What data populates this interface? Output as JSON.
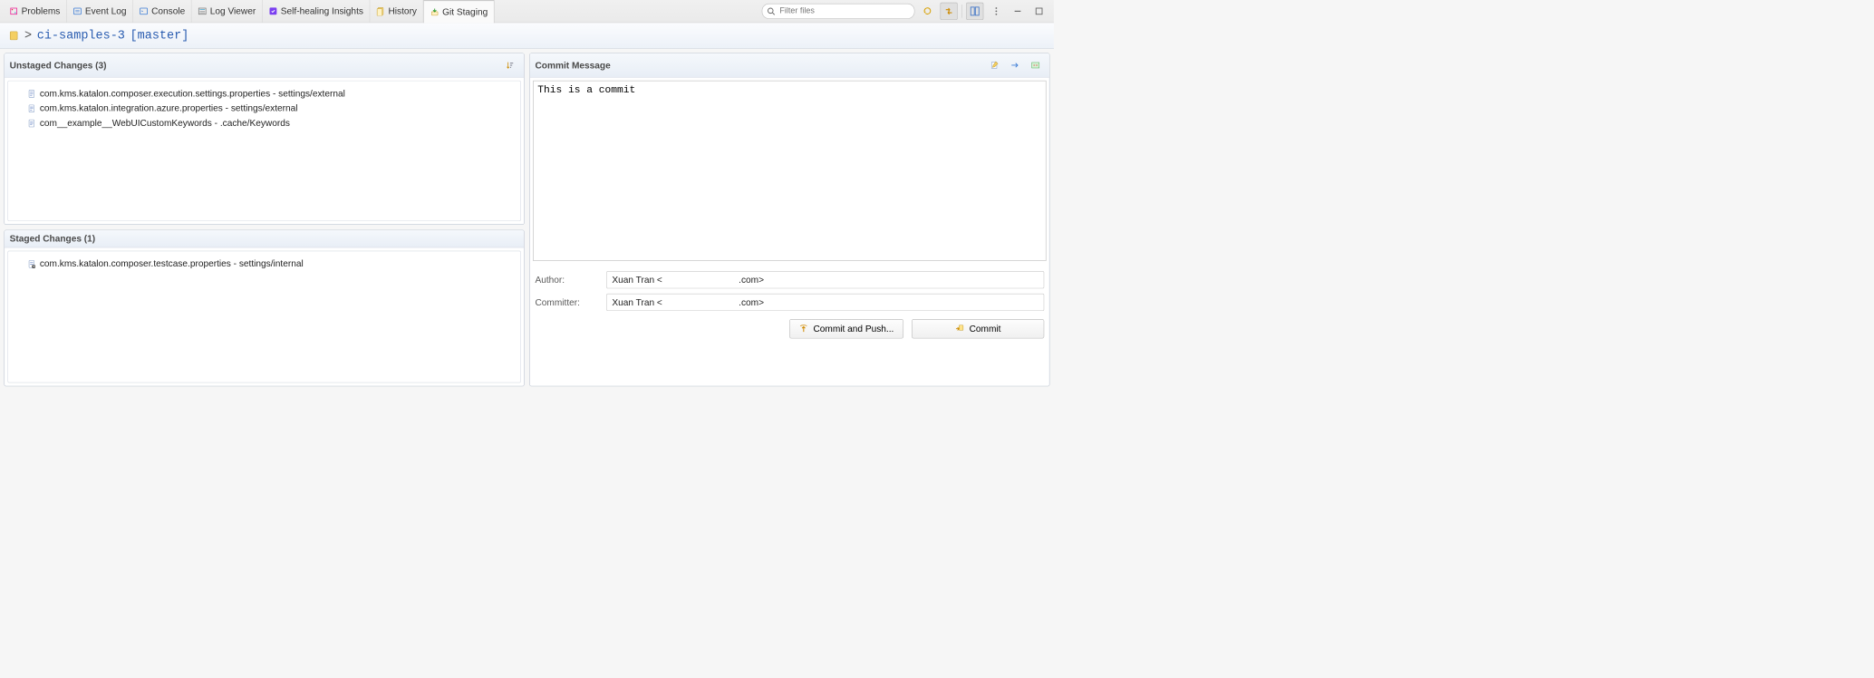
{
  "tabs": [
    {
      "label": "Problems"
    },
    {
      "label": "Event Log"
    },
    {
      "label": "Console"
    },
    {
      "label": "Log Viewer"
    },
    {
      "label": "Self-healing Insights"
    },
    {
      "label": "History"
    },
    {
      "label": "Git Staging"
    }
  ],
  "active_tab_index": 6,
  "filter": {
    "placeholder": "Filter files"
  },
  "breadcrumb": {
    "sep": ">",
    "repo": "ci-samples-3",
    "branch": "[master]"
  },
  "unstaged": {
    "title": "Unstaged Changes (3)",
    "files": [
      "com.kms.katalon.composer.execution.settings.properties - settings/external",
      "com.kms.katalon.integration.azure.properties - settings/external",
      "com__example__WebUICustomKeywords - .cache/Keywords"
    ]
  },
  "staged": {
    "title": "Staged Changes (1)",
    "files": [
      "com.kms.katalon.composer.testcase.properties - settings/internal"
    ]
  },
  "commit": {
    "title": "Commit Message",
    "message": "This is a commit",
    "author_label": "Author:",
    "committer_label": "Committer:",
    "author_value": "Xuan Tran <                              .com>",
    "committer_value": "Xuan Tran <                              .com>",
    "btn_commit_push": "Commit and Push...",
    "btn_commit": "Commit"
  }
}
